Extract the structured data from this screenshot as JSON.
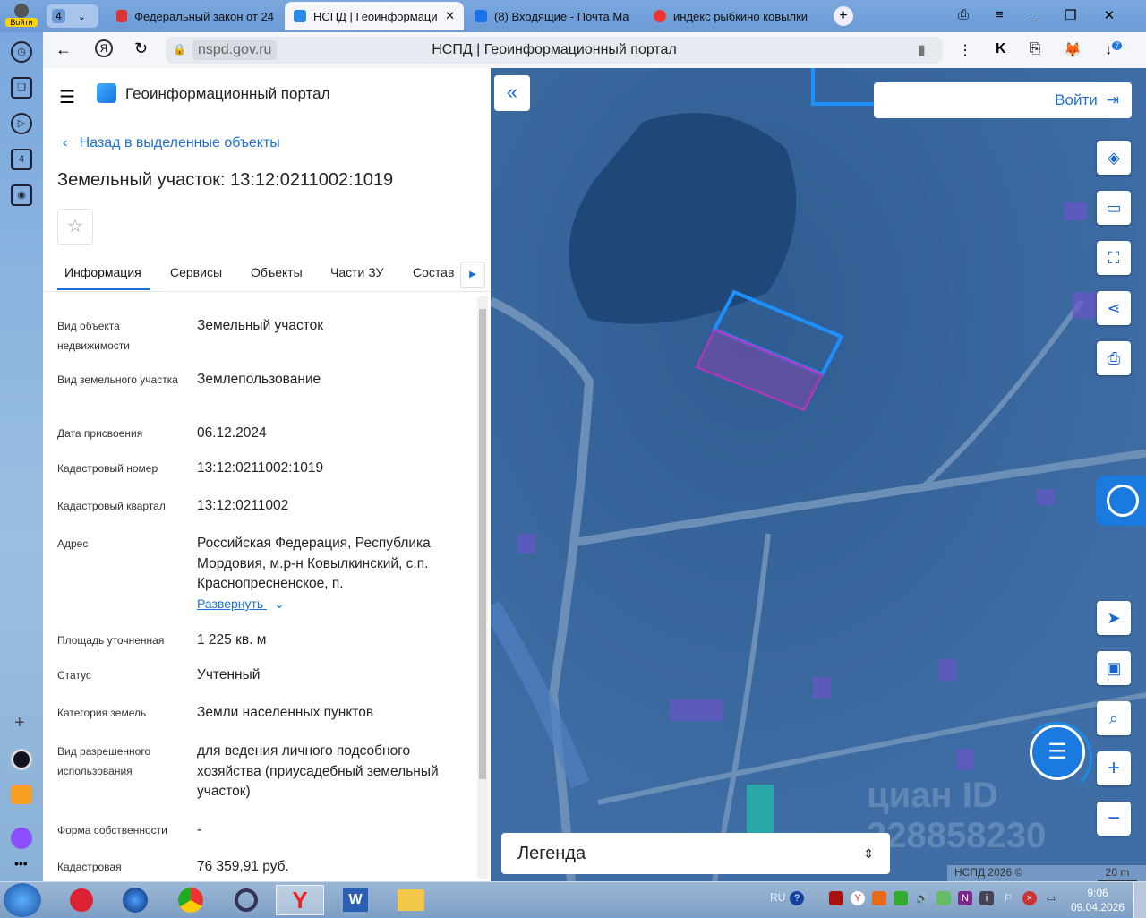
{
  "browser": {
    "login_badge": "Войти",
    "tab_count": "4",
    "tabs": [
      {
        "title": "Федеральный закон от 24",
        "active": false
      },
      {
        "title": "НСПД | Геоинформаци",
        "active": true
      },
      {
        "title": "(8) Входящие - Почта Ma",
        "active": false
      },
      {
        "title": "индекс рыбкино ковылки",
        "active": false
      }
    ],
    "url": "nspd.gov.ru",
    "page_title": "НСПД | Геоинформационный портал",
    "downloads_badge": "7"
  },
  "sidebar_left": {
    "badge": "4"
  },
  "header": {
    "title": "Геоинформационный портал"
  },
  "panel": {
    "back_link": "Назад в выделенные объекты",
    "title": "Земельный участок: 13:12:0211002:1019",
    "tabs": [
      "Информация",
      "Сервисы",
      "Объекты",
      "Части ЗУ",
      "Состав"
    ],
    "active_tab": "Информация",
    "fields": [
      {
        "label": "Вид объекта недвижимости",
        "value": "Земельный участок"
      },
      {
        "label": "Вид земельного участка",
        "value": "Землепользование"
      },
      {
        "label": "Дата присвоения",
        "value": "06.12.2024"
      },
      {
        "label": "Кадастровый номер",
        "value": "13:12:0211002:1019"
      },
      {
        "label": "Кадастровый квартал",
        "value": "13:12:0211002"
      },
      {
        "label": "Адрес",
        "value": "Российская Федерация, Республика Мордовия, м.р-н Ковылкинский, с.п. Краснопресненское, п."
      },
      {
        "label": "Площадь уточненная",
        "value": "1 225 кв. м"
      },
      {
        "label": "Статус",
        "value": "Учтенный"
      },
      {
        "label": "Категория земель",
        "value": "Земли населенных пунктов"
      },
      {
        "label": "Вид разрешенного использования",
        "value": "для ведения личного подсобного хозяйства (приусадебный земельный участок)"
      },
      {
        "label": "Форма собственности",
        "value": "-"
      },
      {
        "label": "Кадастровая",
        "value": "76 359,91 руб."
      }
    ],
    "expand_link": "Развернуть"
  },
  "map": {
    "login_button": "Войти",
    "legend": "Легенда",
    "copyright": "НСПД 2026 ©",
    "scale": "20 m",
    "watermark": "циан ID 328858230",
    "selected_color": "#1e90ff",
    "parcel_color": "#c030c0"
  },
  "taskbar": {
    "lang": "RU",
    "time": "9:06",
    "date": "09.04.2026"
  }
}
